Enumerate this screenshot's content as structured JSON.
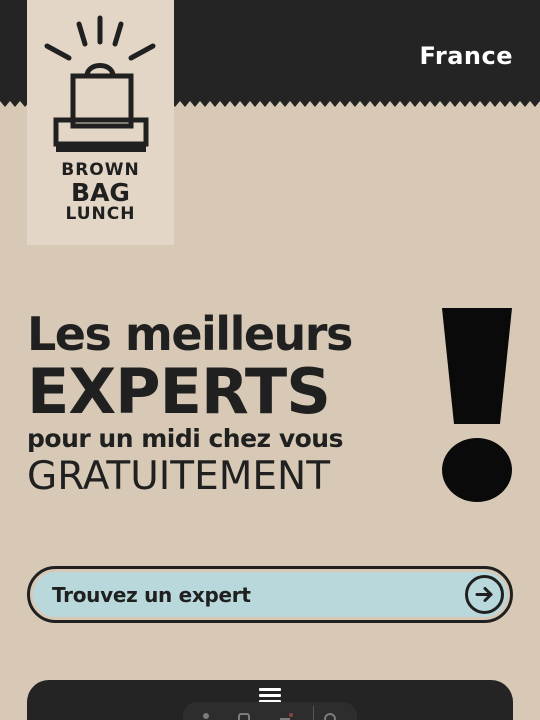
{
  "header": {
    "country_label": "France"
  },
  "logo": {
    "line1": "BROWN",
    "line2": "BAG",
    "line3": "LUNCH"
  },
  "hero": {
    "line1": "Les meilleurs",
    "line2": "EXPERTS",
    "line3": "pour un midi chez vous",
    "line4": "GRATUITEMENT"
  },
  "cta": {
    "label": "Trouvez un expert"
  },
  "icons": {
    "logo": "shopping-bag-logo",
    "exclamation": "exclamation-mark",
    "cta_arrow": "arrow-right-circle-icon",
    "menu": "hamburger-menu-icon"
  },
  "colors": {
    "background": "#d7c9b6",
    "dark": "#232423",
    "logo_card": "#e3d6c6",
    "cta_fill": "#b9d8db",
    "text": "#1f201f"
  }
}
